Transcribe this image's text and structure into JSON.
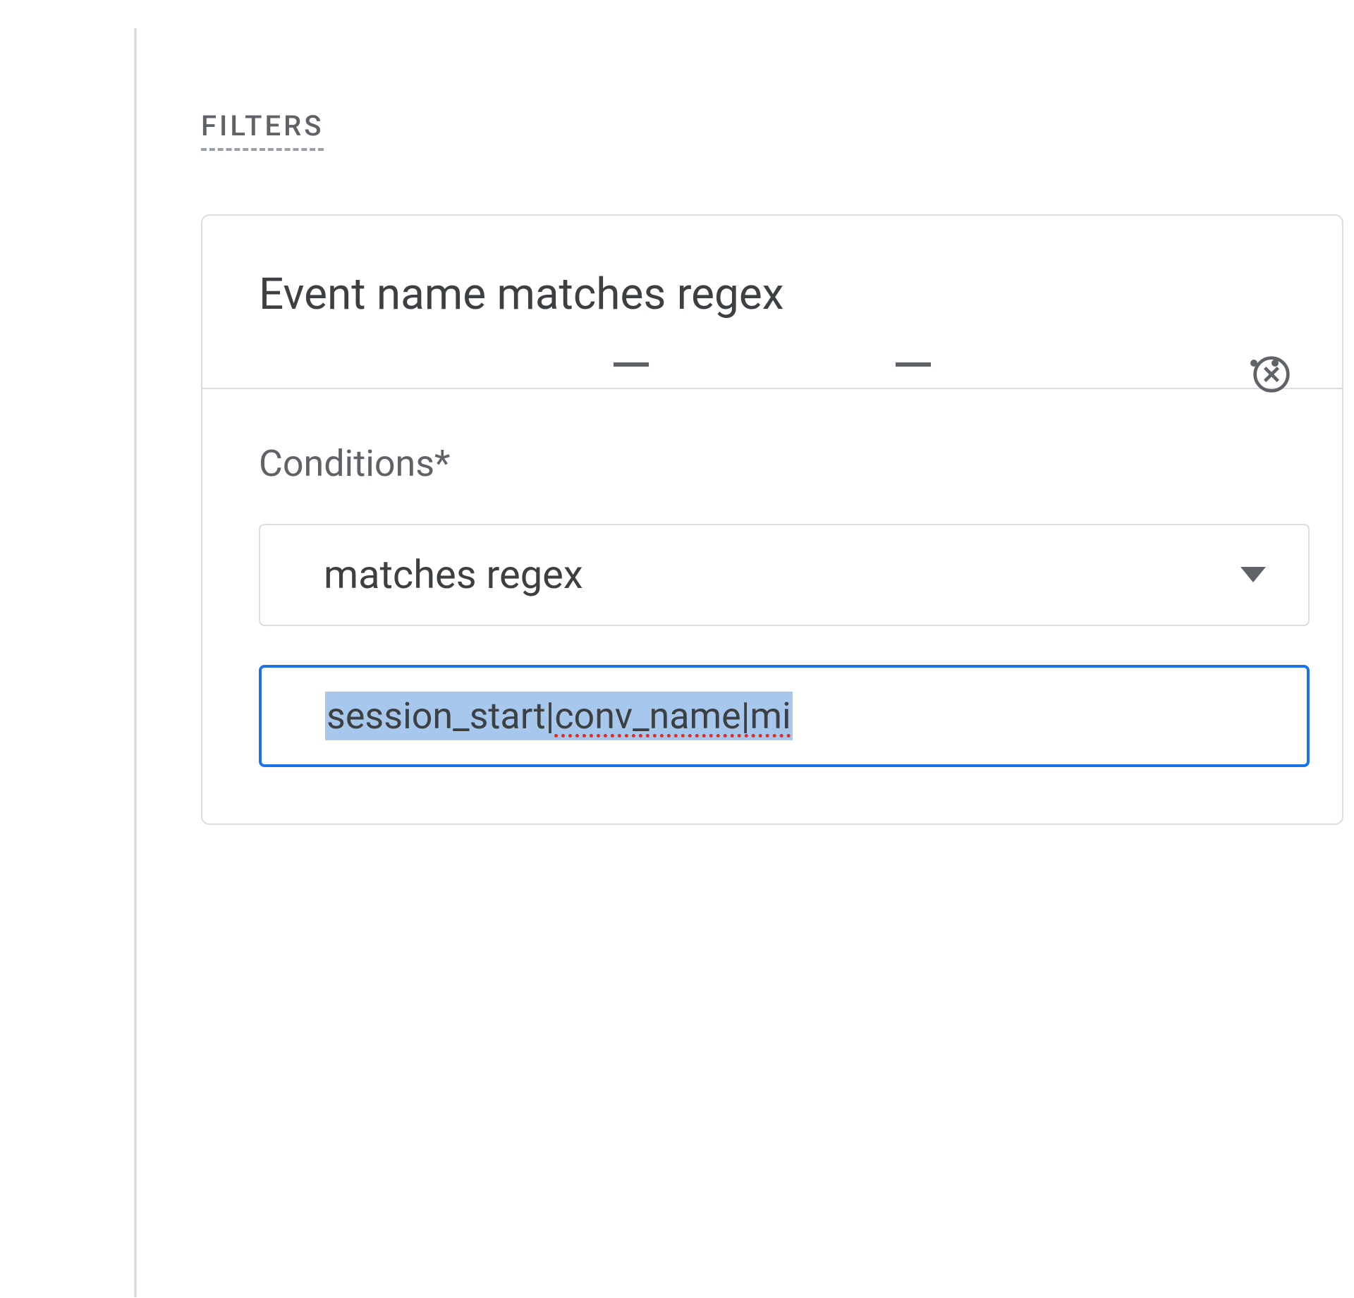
{
  "filters": {
    "heading": "FILTERS",
    "card": {
      "title": "Event name matches regex",
      "conditions_label": "Conditions*",
      "operator_select": {
        "selected": "matches regex"
      },
      "value_input": {
        "value_part1": "session_start|",
        "value_part2": "conv_name|mi"
      }
    }
  }
}
